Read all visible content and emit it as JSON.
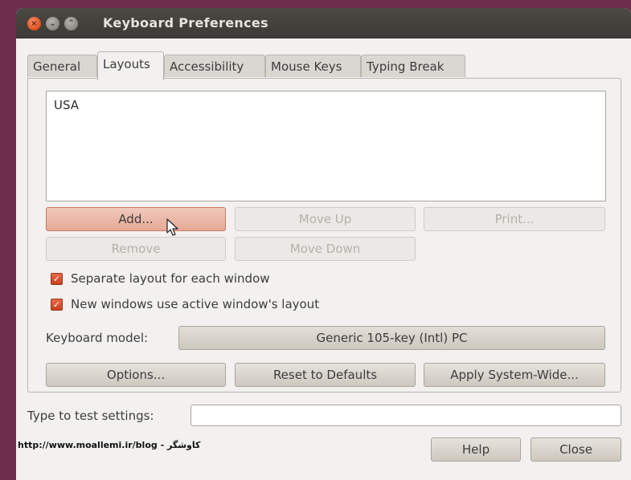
{
  "window": {
    "title": "Keyboard Preferences",
    "controls": {
      "close": "×",
      "minimize": "⌄",
      "maximize": "⌃"
    }
  },
  "tabs": [
    "General",
    "Layouts",
    "Accessibility",
    "Mouse Keys",
    "Typing Break"
  ],
  "active_tab": "Layouts",
  "layouts_list": [
    "USA"
  ],
  "buttons": {
    "add": "Add...",
    "move_up": "Move Up",
    "print": "Print...",
    "remove": "Remove",
    "move_down": "Move Down",
    "options": "Options...",
    "reset": "Reset to Defaults",
    "apply": "Apply System-Wide...",
    "help": "Help",
    "close": "Close"
  },
  "checkboxes": {
    "separate_layout": {
      "label": "Separate layout for each window",
      "checked": true
    },
    "new_windows": {
      "label": "New windows use active window's layout",
      "checked": true
    }
  },
  "keyboard_model": {
    "label": "Keyboard model:",
    "value": "Generic 105-key (Intl) PC"
  },
  "test_settings": {
    "label": "Type to test settings:",
    "value": ""
  },
  "footer_watermark": "http://www.moallemi.ir/blog - کاوشگر",
  "colors": {
    "desktop": "#6e2d4a",
    "titlebar": "#3b3a36",
    "accent": "#e2531f",
    "window_bg": "#f2f1f0"
  }
}
